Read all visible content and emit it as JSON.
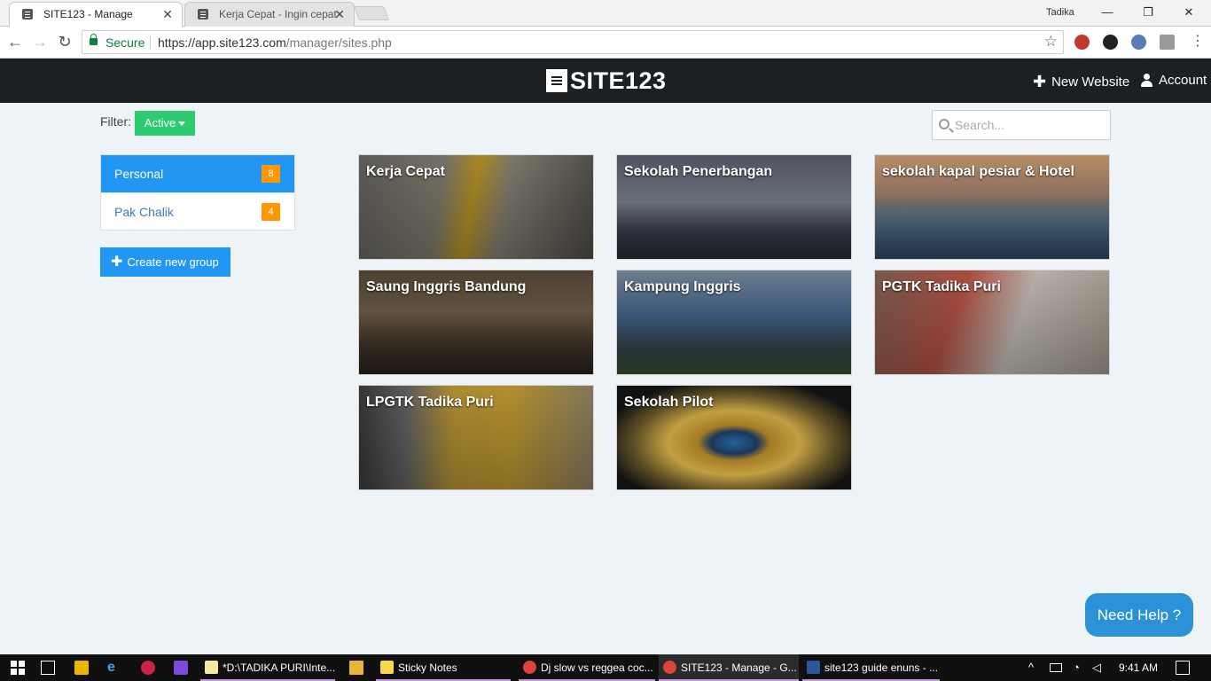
{
  "browser": {
    "tabs": [
      {
        "title": "SITE123 - Manage",
        "active": true
      },
      {
        "title": "Kerja Cepat - Ingin cepat",
        "active": false
      }
    ],
    "window_user": "Tadika",
    "secure_label": "Secure",
    "url_host": "https://app.site123.com",
    "url_path": "/manager/sites.php"
  },
  "header": {
    "logo_text": "SITE123",
    "new_website_label": "New Website",
    "account_label": "Account"
  },
  "filter": {
    "label": "Filter:",
    "selected": "Active"
  },
  "search": {
    "placeholder": "Search..."
  },
  "groups": [
    {
      "name": "Personal",
      "count": "8",
      "selected": true
    },
    {
      "name": "Pak Chalik",
      "count": "4",
      "selected": false
    }
  ],
  "create_group_label": "Create new group",
  "sites": [
    {
      "title": "Kerja Cepat"
    },
    {
      "title": "Sekolah Penerbangan"
    },
    {
      "title": "sekolah kapal pesiar & Hotel"
    },
    {
      "title": "Saung Inggris Bandung"
    },
    {
      "title": "Kampung Inggris"
    },
    {
      "title": "PGTK Tadika Puri"
    },
    {
      "title": "LPGTK Tadika Puri"
    },
    {
      "title": "Sekolah Pilot"
    }
  ],
  "help_label": "Need Help ?",
  "taskbar": {
    "items": [
      {
        "label": "*D:\\TADIKA PURI\\Inte...",
        "icon": "notepad-icon"
      },
      {
        "label": "Sticky Notes",
        "icon": "sticky-notes-icon"
      },
      {
        "label": "Dj slow vs reggea coc...",
        "icon": "chrome-icon"
      },
      {
        "label": "SITE123 - Manage - G...",
        "icon": "chrome-icon"
      },
      {
        "label": "site123 guide enuns - ...",
        "icon": "word-icon"
      }
    ],
    "time": "9:41 AM"
  },
  "colors": {
    "header_bg": "#1d2022",
    "page_bg": "#edf3f6",
    "primary": "#2196f3",
    "filter_green": "#2ecc71",
    "badge_orange": "#ff9800",
    "help_blue": "#2b92d8"
  }
}
